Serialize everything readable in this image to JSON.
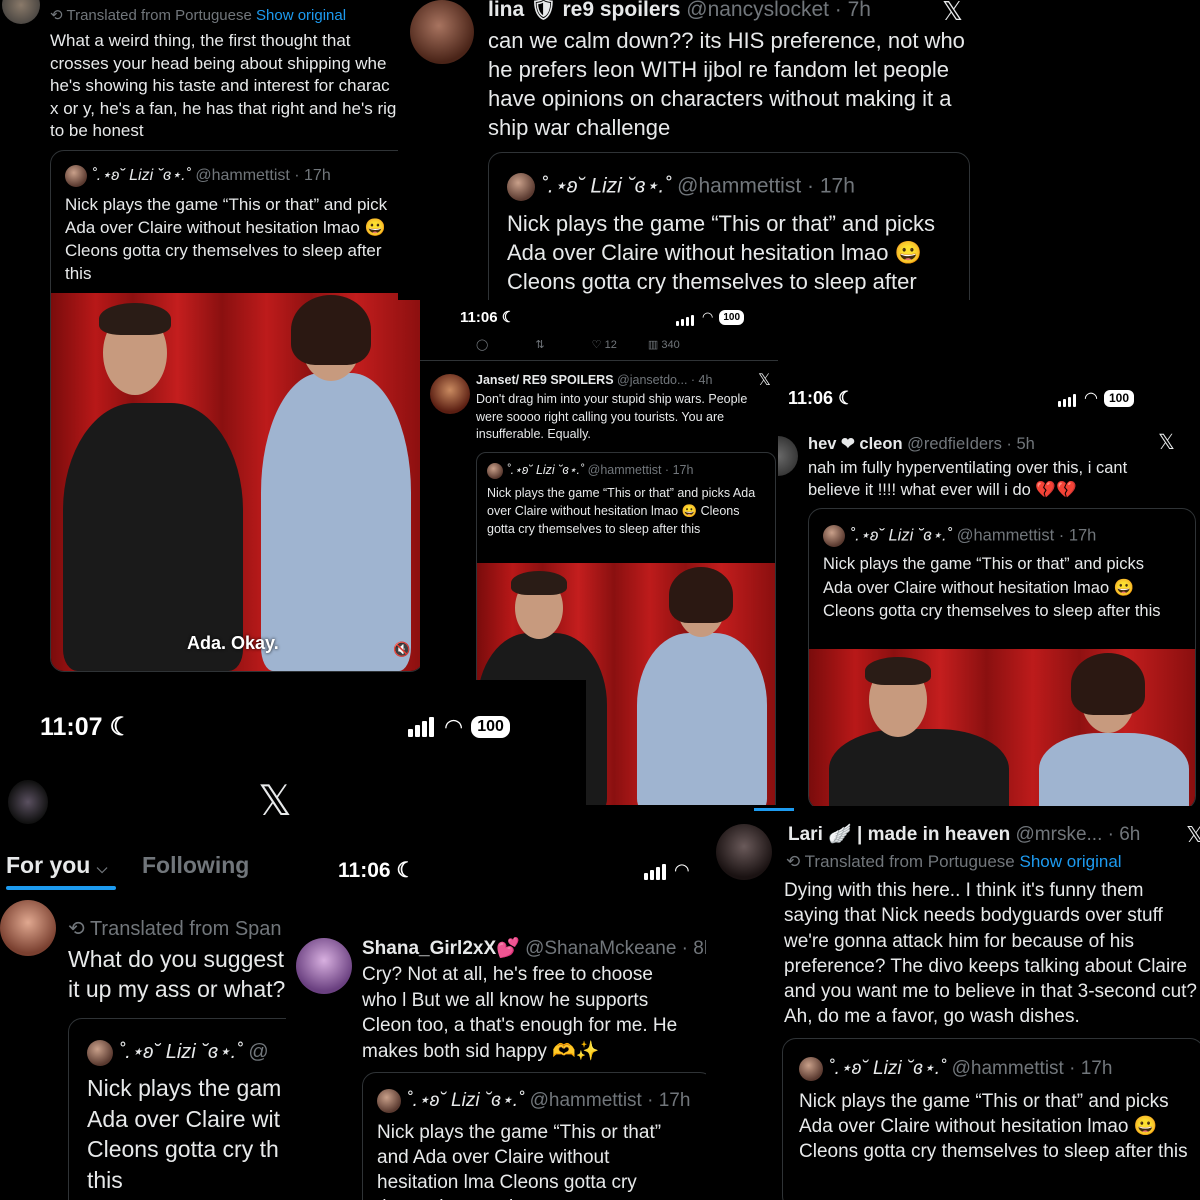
{
  "p1": {
    "translated": "Translated from Portuguese",
    "show_original": "Show original",
    "body": "What a weird thing, the first thought that crosses your head being about shipping whe he's showing his taste and interest for charac x or y, he's a fan, he has that right and he's rig to be honest",
    "quote": {
      "name": "˚.⋆ʚ˘ Lizi ˘ɞ⋆.˚",
      "handle": "@hammettist · 17h",
      "text": "Nick plays the game “This or that” and pick Ada over Claire without hesitation lmao 😀 Cleons gotta cry themselves to sleep after this"
    },
    "caption": "Ada. Okay."
  },
  "p2": {
    "name": "lina 🛡 re9 spoilers",
    "handle": "@nancyslocket · 7h",
    "body": "can we calm down?? its HIS preference, not who he prefers leon WITH ijbol re fandom let people have opinions on characters without making it a ship war challenge",
    "quote": {
      "name": "˚.⋆ʚ˘ Lizi ˘ɞ⋆.˚",
      "handle": "@hammettist · 17h",
      "text": "Nick plays the game “This or that” and picks Ada over Claire without hesitation lmao 😀 Cleons gotta cry themselves to sleep after"
    }
  },
  "p3": {
    "time": "11:06",
    "battery": "100",
    "actions": {
      "likes": "12",
      "views": "340"
    },
    "name": "Janset/ RE9 SPOILERS",
    "handle": "@jansetdo... · 4h",
    "body": "Don't drag him into your stupid ship wars. People were soooo right calling you tourists. You are insufferable. Equally.",
    "quote": {
      "name": "˚.⋆ʚ˘ Lizi ˘ɞ⋆.˚",
      "handle": "@hammettist · 17h",
      "text": "Nick plays the game “This or that” and picks Ada over Claire without hesitation lmao 😀 Cleons gotta cry themselves to sleep after this"
    }
  },
  "p4": {
    "time": "11:06",
    "battery": "100",
    "name": "hev ❤ cleon",
    "handle": "@redfieIders · 5h",
    "body": "nah im fully hyperventilating over this, i cant believe it !!!! what ever will i do 💔💔",
    "quote": {
      "name": "˚.⋆ʚ˘ Lizi ˘ɞ⋆.˚",
      "handle": "@hammettist · 17h",
      "text": "Nick plays the game “This or that” and picks Ada over Claire without hesitation lmao 😀 Cleons gotta cry themselves to sleep after this"
    }
  },
  "p5": {
    "time": "11:07",
    "battery": "100",
    "tabs": [
      "For you",
      "Following"
    ],
    "translated": "Translated from Span",
    "body": "What do you suggest it up my ass or what?",
    "quote": {
      "name": "˚.⋆ʚ˘ Lizi ˘ɞ⋆.˚",
      "handle": "@",
      "text": "Nick plays the gam Ada over Claire wit Cleons gotta cry th this"
    }
  },
  "p6": {
    "time": "11:06",
    "name": "Shana_Girl2xX💕",
    "handle": "@ShanaMckeane · 8h",
    "body": "Cry? Not at all, he's free to choose who l But we all know he supports Cleon too, a that's enough for me. He makes both sid happy 🫶✨",
    "quote": {
      "name": "˚.⋆ʚ˘ Lizi ˘ɞ⋆.˚",
      "handle": "@hammettist · 17h",
      "text": "Nick plays the game “This or that” and Ada over Claire without hesitation lma Cleons gotta cry themselves to sleep a"
    }
  },
  "p7": {
    "name": "Lari 🪽 | made in heaven",
    "handle": "@mrske... · 6h",
    "translated": "Translated from Portuguese",
    "show_original": "Show original",
    "body": "Dying with this here.. I think it's funny them saying that Nick needs bodyguards over stuff we're gonna attack him for because of his preference? The divo keeps talking about Claire and you want me to believe in that 3-second cut? Ah, do me a favor, go wash dishes.",
    "quote": {
      "name": "˚.⋆ʚ˘ Lizi ˘ɞ⋆.˚",
      "handle": "@hammettist · 17h",
      "text": "Nick plays the game “This or that” and picks Ada over Claire without hesitation lmao 😀 Cleons gotta cry themselves to sleep after this"
    }
  },
  "x_close": "✕",
  "x_logo": "𝕏"
}
